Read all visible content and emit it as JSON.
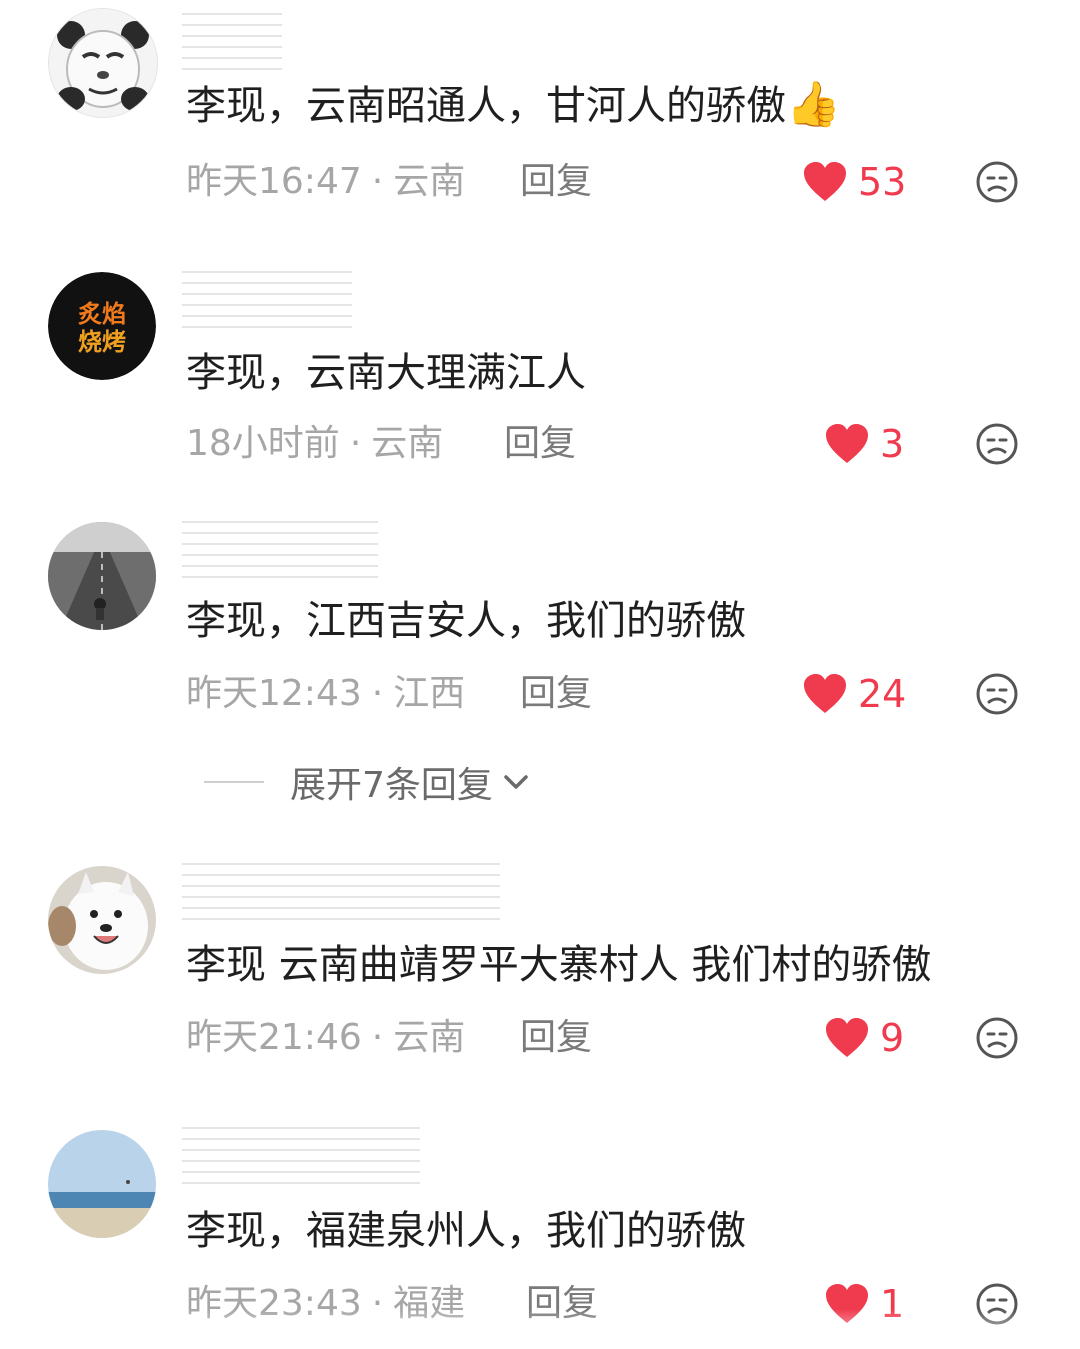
{
  "comments": [
    {
      "text": "李现，云南昭通人，甘河人的骄傲",
      "emoji": "👍",
      "time": "昨天16:47",
      "region": "云南",
      "reply_label": "回复",
      "likes": "53",
      "avatar": "panda-meme-avatar"
    },
    {
      "text": "李现，云南大理满江人",
      "emoji": "",
      "time": "18小时前",
      "region": "云南",
      "reply_label": "回复",
      "likes": "3",
      "avatar": "bbq-logo-avatar",
      "avatar_text": "炙焰烧烤"
    },
    {
      "text": "李现，江西吉安人，我们的骄傲",
      "emoji": "",
      "time": "昨天12:43",
      "region": "江西",
      "reply_label": "回复",
      "likes": "24",
      "avatar": "road-photo-avatar"
    },
    {
      "text": "李现 云南曲靖罗平大寨村人 我们村的骄傲",
      "emoji": "",
      "time": "昨天21:46",
      "region": "云南",
      "reply_label": "回复",
      "likes": "9",
      "avatar": "samoyed-dog-avatar"
    },
    {
      "text": "李现，福建泉州人，我们的骄傲",
      "emoji": "",
      "time": "昨天23:43",
      "region": "福建",
      "reply_label": "回复",
      "likes": "1",
      "avatar": "beach-photo-avatar"
    }
  ],
  "expand_replies": {
    "label": "展开7条回复"
  },
  "colors": {
    "like": "#f03a4d",
    "meta": "#a6a6a6",
    "text": "#1f1f1f"
  }
}
